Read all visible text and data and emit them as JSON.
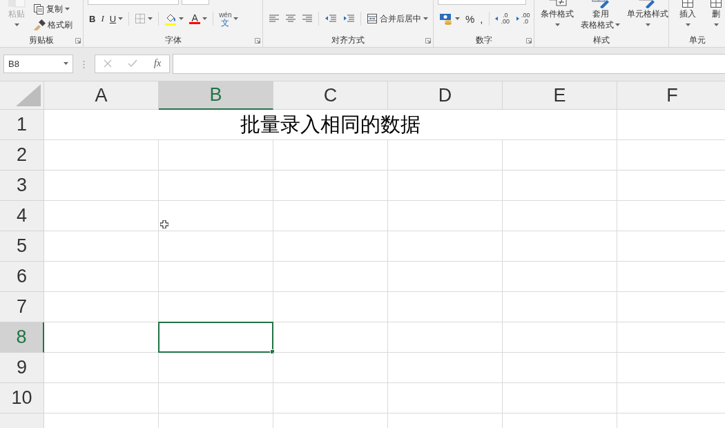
{
  "ribbon": {
    "groups": [
      {
        "label": "剪贴板",
        "launcher": true,
        "items": [
          {
            "kind": "paste",
            "label": "粘贴",
            "disabled": true,
            "dropdown": true
          },
          {
            "kind": "stack",
            "items": [
              {
                "kind": "copy",
                "label": "复制",
                "dropdown": true
              },
              {
                "kind": "painter",
                "label": "格式刷",
                "dropdown": false
              }
            ]
          }
        ]
      },
      {
        "label": "字体",
        "launcher": true,
        "items": [
          {
            "kind": "rows",
            "items": [
              {
                "kind": "row",
                "items": [
                  {
                    "kind": "font-field"
                  },
                  {
                    "kind": "size-field"
                  }
                ]
              },
              {
                "kind": "row",
                "items": [
                  {
                    "kind": "bold",
                    "label": "B",
                    "dropdown": false
                  },
                  {
                    "kind": "italic",
                    "label": "I",
                    "dropdown": false
                  },
                  {
                    "kind": "underline",
                    "label": "U",
                    "dropdown": true
                  },
                  {
                    "kind": "separator"
                  },
                  {
                    "kind": "borders",
                    "dropdown": true
                  },
                  {
                    "kind": "separator"
                  },
                  {
                    "kind": "fill-color",
                    "color": "#ffff00",
                    "dropdown": true
                  },
                  {
                    "kind": "font-color",
                    "label": "A",
                    "color": "#ff0000",
                    "dropdown": true
                  },
                  {
                    "kind": "separator"
                  },
                  {
                    "kind": "phonetic",
                    "top": "wén",
                    "bottom": "文",
                    "dropdown": true
                  }
                ]
              }
            ]
          }
        ]
      },
      {
        "label": "对齐方式",
        "launcher": true,
        "items": [
          {
            "kind": "rows",
            "items": [
              {
                "kind": "row",
                "items": [
                  {
                    "kind": "align-left"
                  },
                  {
                    "kind": "align-center"
                  },
                  {
                    "kind": "align-right"
                  },
                  {
                    "kind": "separator"
                  },
                  {
                    "kind": "indent-less"
                  },
                  {
                    "kind": "indent-more"
                  },
                  {
                    "kind": "separator"
                  },
                  {
                    "kind": "merge",
                    "label": "合并后居中",
                    "dropdown": true
                  }
                ]
              }
            ]
          }
        ]
      },
      {
        "label": "数字",
        "launcher": true,
        "items": [
          {
            "kind": "rows",
            "items": [
              {
                "kind": "row",
                "items": [
                  {
                    "kind": "format-field"
                  }
                ]
              },
              {
                "kind": "row",
                "items": [
                  {
                    "kind": "accounting",
                    "dropdown": true
                  },
                  {
                    "kind": "percent",
                    "label": "%",
                    "dropdown": false
                  },
                  {
                    "kind": "comma",
                    "label": ",",
                    "dropdown": false
                  },
                  {
                    "kind": "separator"
                  },
                  {
                    "kind": "decimal-more",
                    "top": ".0",
                    "bottom": ".00"
                  },
                  {
                    "kind": "decimal-less",
                    "top": ".00",
                    "bottom": ".0"
                  }
                ]
              }
            ]
          }
        ]
      },
      {
        "label": "样式",
        "launcher": false,
        "items": [
          {
            "kind": "conditional",
            "lines": [
              "条件格式"
            ],
            "dropdown": true
          },
          {
            "kind": "table-format",
            "lines": [
              "套用",
              "表格格式"
            ],
            "dropdown": true
          },
          {
            "kind": "cell-style",
            "lines": [
              "单元格样式"
            ],
            "dropdown": true
          }
        ]
      },
      {
        "label": "单元",
        "launcher": false,
        "items": [
          {
            "kind": "insert",
            "lines": [
              "插入"
            ],
            "dropdown": true
          },
          {
            "kind": "delete",
            "lines": [
              "删"
            ],
            "dropdown": true
          }
        ]
      }
    ]
  },
  "formula_bar": {
    "name_box": "B8",
    "function_label": "fx"
  },
  "sheet": {
    "columns": [
      {
        "label": "A",
        "selected": false
      },
      {
        "label": "B",
        "selected": true
      },
      {
        "label": "C",
        "selected": false
      },
      {
        "label": "D",
        "selected": false
      },
      {
        "label": "E",
        "selected": false
      },
      {
        "label": "F",
        "selected": false
      }
    ],
    "rows": [
      {
        "label": "1",
        "selected": false
      },
      {
        "label": "2",
        "selected": false
      },
      {
        "label": "3",
        "selected": false
      },
      {
        "label": "4",
        "selected": false
      },
      {
        "label": "5",
        "selected": false
      },
      {
        "label": "6",
        "selected": false
      },
      {
        "label": "7",
        "selected": false
      },
      {
        "label": "8",
        "selected": true
      },
      {
        "label": "9",
        "selected": false
      },
      {
        "label": "10",
        "selected": false
      }
    ],
    "title_cell": "批量录入相同的数据"
  }
}
